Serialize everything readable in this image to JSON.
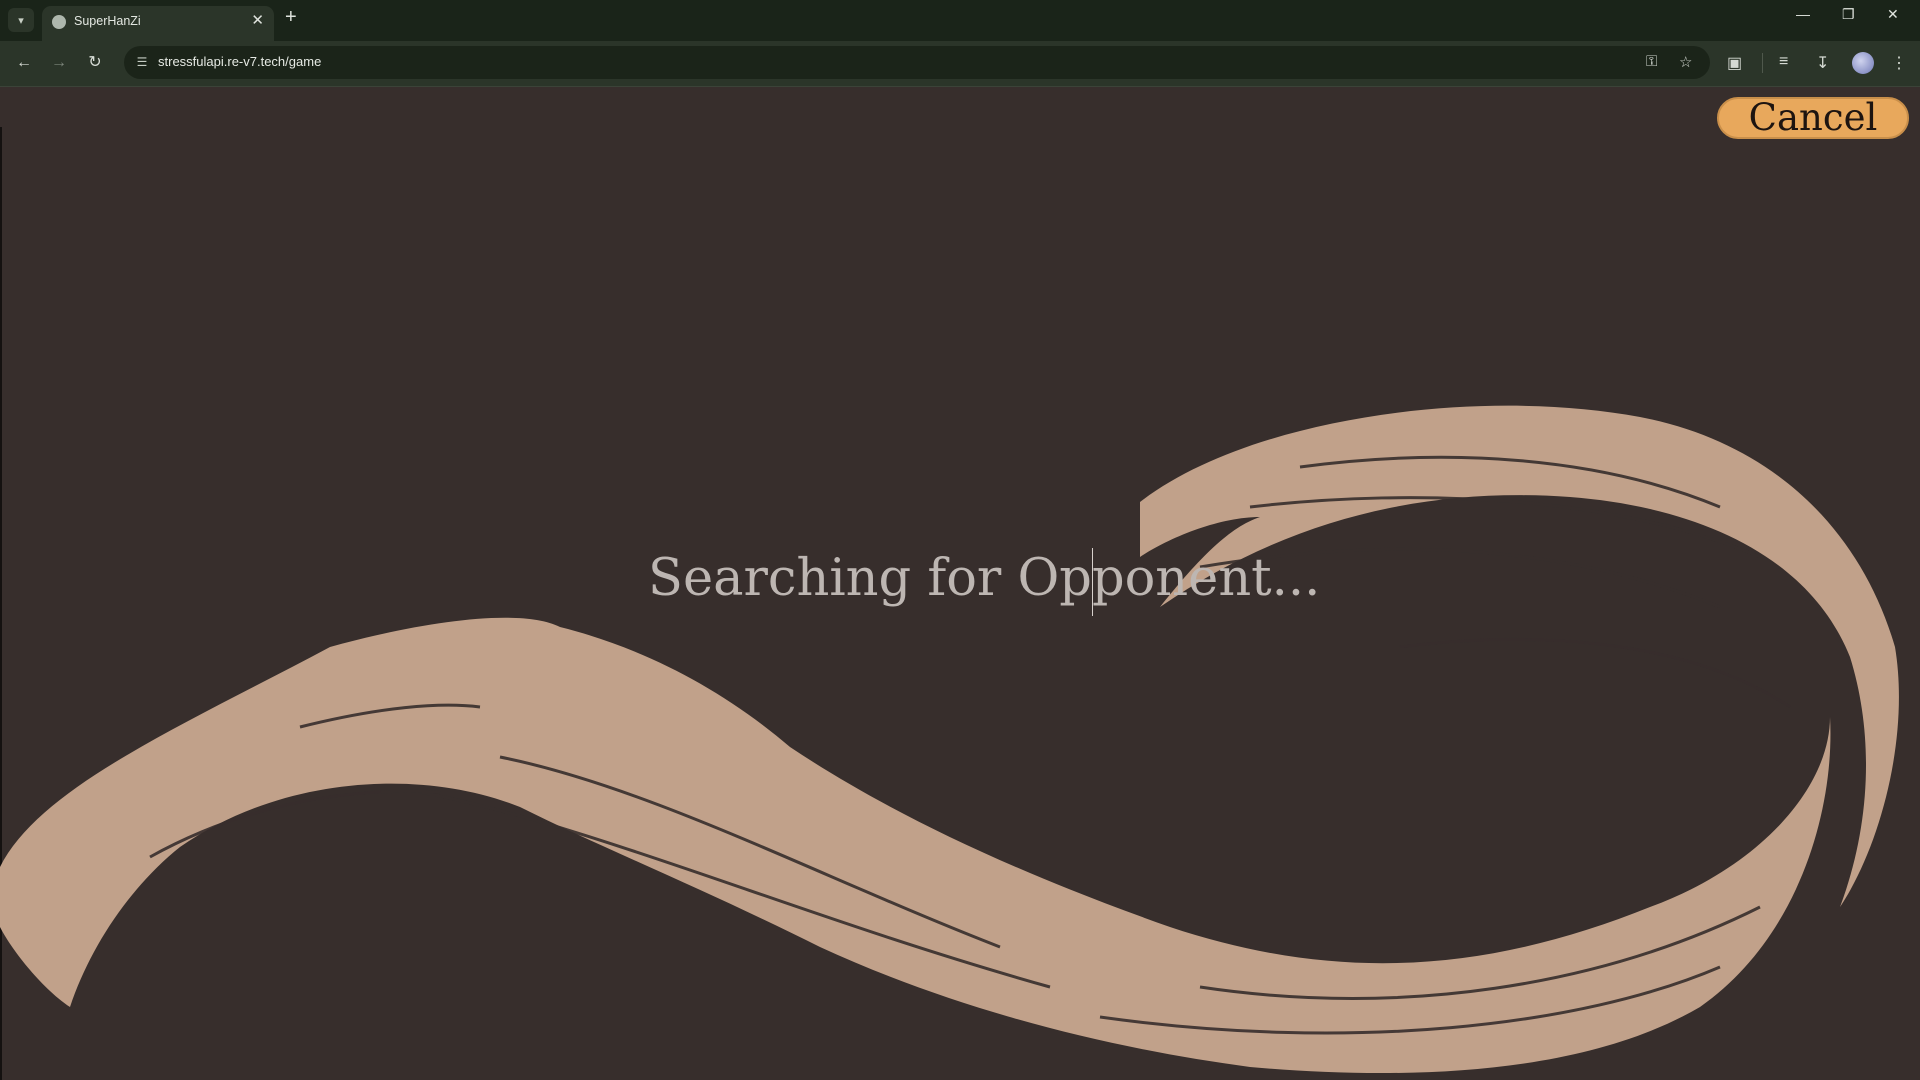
{
  "browser": {
    "tab_title": "SuperHanZi",
    "url": "stressfulapi.re-v7.tech/game",
    "new_tab_label": "+",
    "tab_close_label": "✕"
  },
  "page": {
    "cancel_label": "Cancel",
    "status_text": "Searching for Opponent..."
  },
  "colors": {
    "background": "#372e2c",
    "brush": "#c1a18a",
    "cancel_button": "#e8a85c",
    "status_text": "#bdb6b2"
  },
  "icons": {
    "back": "arrow-left",
    "forward": "arrow-right",
    "reload": "reload",
    "site_settings": "tune",
    "password": "key",
    "bookmark": "star",
    "extensions": "puzzle",
    "media": "playlist",
    "downloads": "download",
    "menu": "kebab"
  }
}
